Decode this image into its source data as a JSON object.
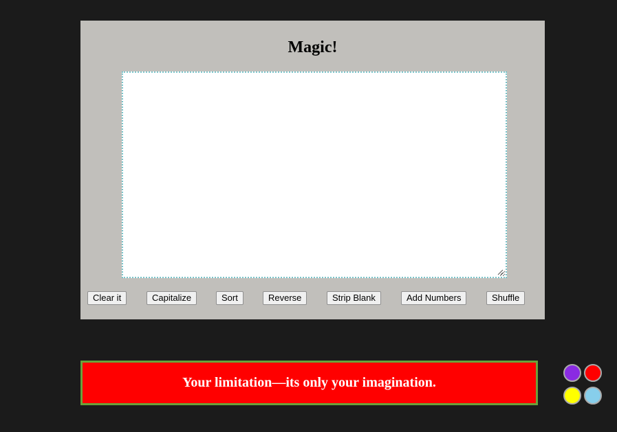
{
  "app": {
    "title": "Magic!",
    "textarea_value": ""
  },
  "toolbar": {
    "buttons": [
      {
        "label": "Clear it"
      },
      {
        "label": "Capitalize"
      },
      {
        "label": "Sort"
      },
      {
        "label": "Reverse"
      },
      {
        "label": "Strip Blank"
      },
      {
        "label": "Add Numbers"
      },
      {
        "label": "Shuffle"
      }
    ]
  },
  "banner": {
    "text": "Your limitation—its only your imagination."
  },
  "color_swatches": [
    {
      "name": "purple",
      "color": "#8a2be2"
    },
    {
      "name": "red",
      "color": "#ff0000"
    },
    {
      "name": "yellow",
      "color": "#ffff00"
    },
    {
      "name": "light-blue",
      "color": "#87ceeb"
    }
  ],
  "theme": {
    "page_background": "#1b1b1b",
    "panel_background": "#c1bfbb",
    "textarea_border": "#79c3c9",
    "banner_background": "#ff0000",
    "banner_border": "#6aa23a"
  }
}
